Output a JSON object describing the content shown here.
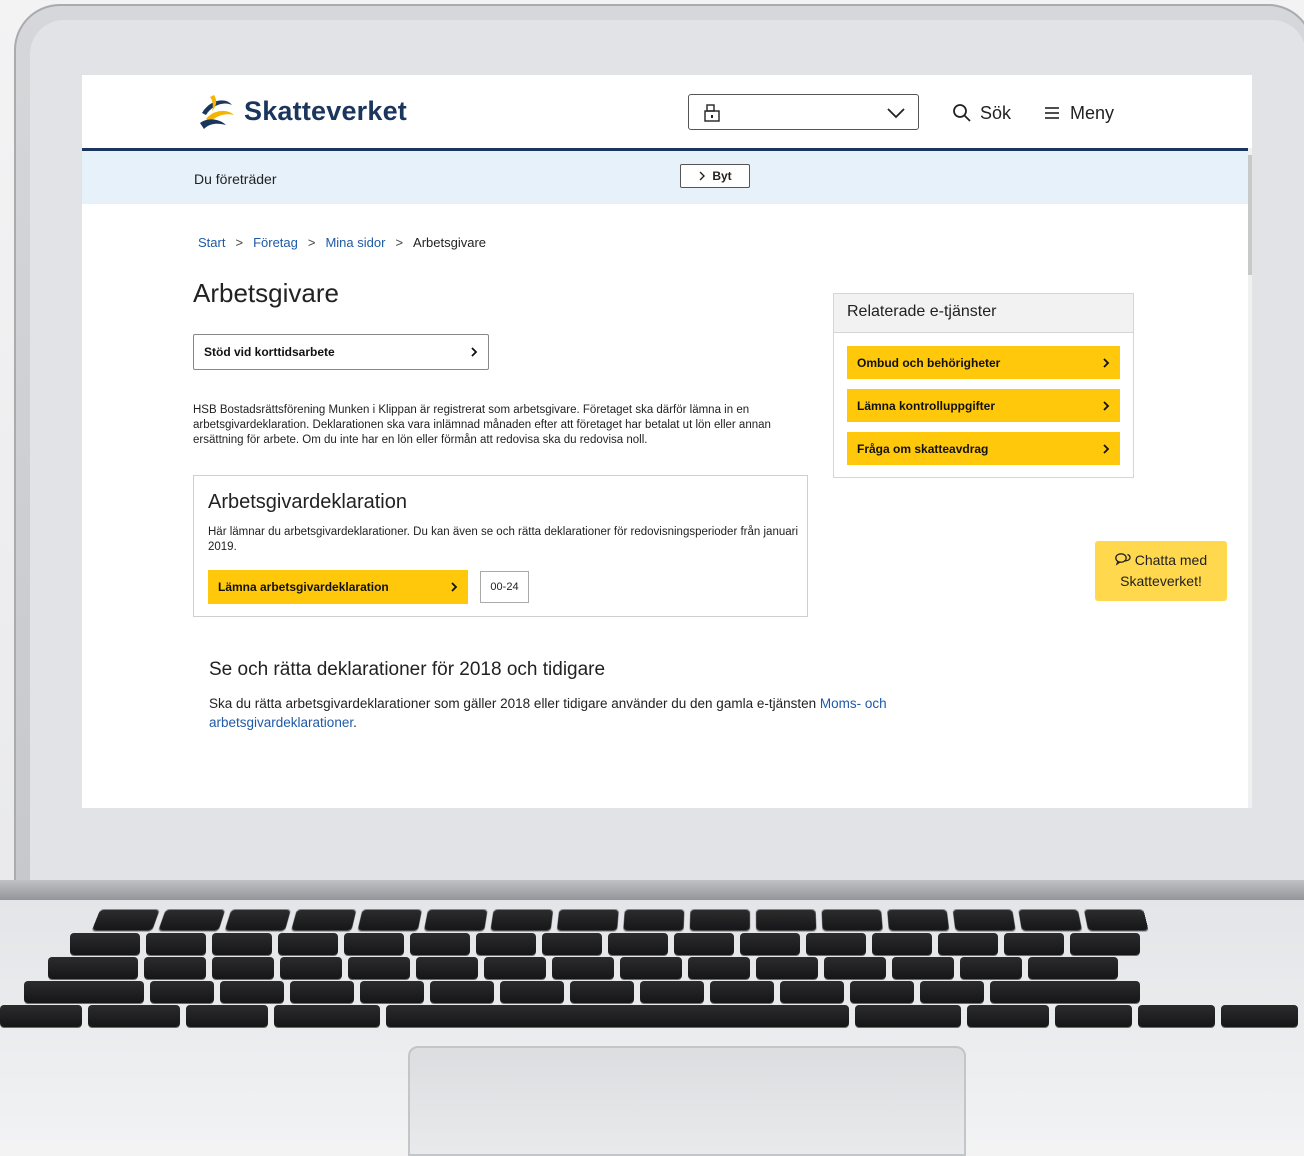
{
  "header": {
    "logo_text": "Skatteverket",
    "search_label": "Sök",
    "menu_label": "Meny"
  },
  "representation": {
    "label": "Du företräder",
    "switch_label": "Byt"
  },
  "breadcrumb": [
    "Start",
    "Företag",
    "Mina sidor",
    "Arbetsgivare"
  ],
  "page": {
    "title": "Arbetsgivare",
    "support_link": "Stöd vid korttidsarbete",
    "intro": "HSB Bostadsrättsförening Munken i Klippan är registrerat som arbetsgivare. Företaget ska därför lämna in en arbetsgivardeklaration. Deklarationen ska vara inlämnad månaden efter att företaget har betalat ut lön eller annan ersättning för arbete. Om du inte har en lön eller förmån att redovisa ska du redovisa noll."
  },
  "declaration_card": {
    "title": "Arbetsgivardeklaration",
    "description": "Här lämnar du arbetsgivardeklarationer. Du kan även se och rätta deklarationer för redovisningsperioder från januari 2019.",
    "button_label": "Lämna arbetsgivardeklaration",
    "hours": "00-24"
  },
  "older_section": {
    "title": "Se och rätta deklarationer för 2018 och tidigare",
    "text": "Ska du rätta arbetsgivardeklarationer som gäller 2018 eller tidigare använder du den gamla e-tjänsten",
    "link": "Moms- och arbetsgivardeklarationer",
    "text_end": "."
  },
  "related": {
    "title": "Relaterade e-tjänster",
    "items": [
      {
        "label": "Ombud och behörigheter"
      },
      {
        "label": "Lämna kontrolluppgifter"
      },
      {
        "label": "Fråga om skatteavdrag"
      }
    ]
  },
  "chat": {
    "line1": "Chatta med",
    "line2": "Skatteverket!"
  },
  "colors": {
    "brand_navy": "#1b365d",
    "accent_yellow": "#ffc80a",
    "link_blue": "#1f5aa6",
    "rep_bar": "#e6f1f9"
  }
}
